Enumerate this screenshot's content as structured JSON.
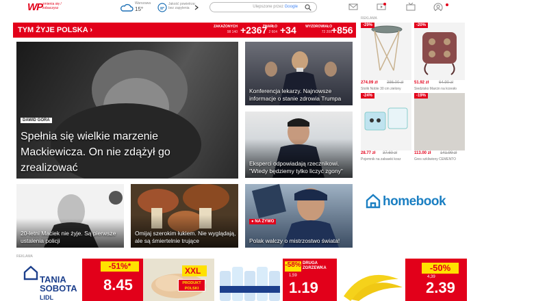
{
  "header": {
    "logo_text": "WP",
    "logo_sub": "zmienia się / zobaczysz",
    "weather_label": "Warszawa",
    "weather_temp": "15°",
    "air_label": "Jakość powietrza: bez zapylenia",
    "search_powered": "Ulepszone przez",
    "search_brand": "Google"
  },
  "strip": {
    "title": "TYM ŻYJE POLSKA",
    "stats": [
      {
        "name": "ZAKAŻONYCH",
        "total": "98 140",
        "delta": "+2367"
      },
      {
        "name": "ZMARŁO",
        "total": "2 604",
        "delta": "+34"
      },
      {
        "name": "WYZDROWIAŁO",
        "total": "72 200",
        "delta": "+856"
      }
    ]
  },
  "news": {
    "main": {
      "tag": "DAWID GÓRA",
      "title": "Spełnia się wielkie marzenie Mackiewicza. On nie zdążył go zrealizować"
    },
    "right1": {
      "title": "Konferencja lekarzy. Najnowsze informacje o stanie zdrowia Trumpa"
    },
    "right2": {
      "title": "Eksperci odpowiadają rzecznikowi. \"Wtedy będziemy tylko liczyć zgony\""
    },
    "bottom1": {
      "title": "20-letni Maciek nie żyje. Są pierwsze ustalenia policji"
    },
    "bottom2": {
      "title": "Omijaj szerokim łukiem. Nie wyglądają, ale są śmiertelnie trujące"
    },
    "bottom3": {
      "tag": "NA ŻYWO",
      "title": "Polak walczy o mistrzostwo świata!"
    }
  },
  "ads": {
    "label": "REKLAMA",
    "products": [
      {
        "discount": "-29%",
        "price": "274.09 zł",
        "old": "386.00 zł",
        "name": "Stolik Noble 30 cm zielony"
      },
      {
        "discount": "-20%",
        "price": "51.92 zł",
        "old": "64.90 zł",
        "name": "Siedzisko Marcin na krzesło"
      },
      {
        "discount": "-24%",
        "price": "28.77 zł",
        "old": "37.60 zł",
        "name": "Pojemnik na zabawki kosz"
      },
      {
        "discount": "-19%",
        "price": "113.00 zł",
        "old": "141.99 zł",
        "name": "Gres szkliwiony CEMENTO"
      }
    ],
    "homebook": "homebook"
  },
  "banner": {
    "label": "REKLAMA",
    "brand": "TANIA SOBOTA",
    "brand_sub": "LIDL",
    "offers": [
      {
        "pct": "-51%*",
        "price": "8.45"
      },
      {
        "pct": "XXL",
        "label": "PRODUKT POLSKI"
      },
      {
        "pct": "-58%",
        "extra": "DRUGA ZGRZEWKA",
        "old": "1,59",
        "price": "1.19"
      },
      {
        "pct": "-50%",
        "old": "4,39",
        "price": "2.39"
      }
    ]
  },
  "colors": {
    "brand_red": "#e2001a",
    "homebook_blue": "#1b7fc2",
    "lidl_yellow": "#ffe100"
  }
}
